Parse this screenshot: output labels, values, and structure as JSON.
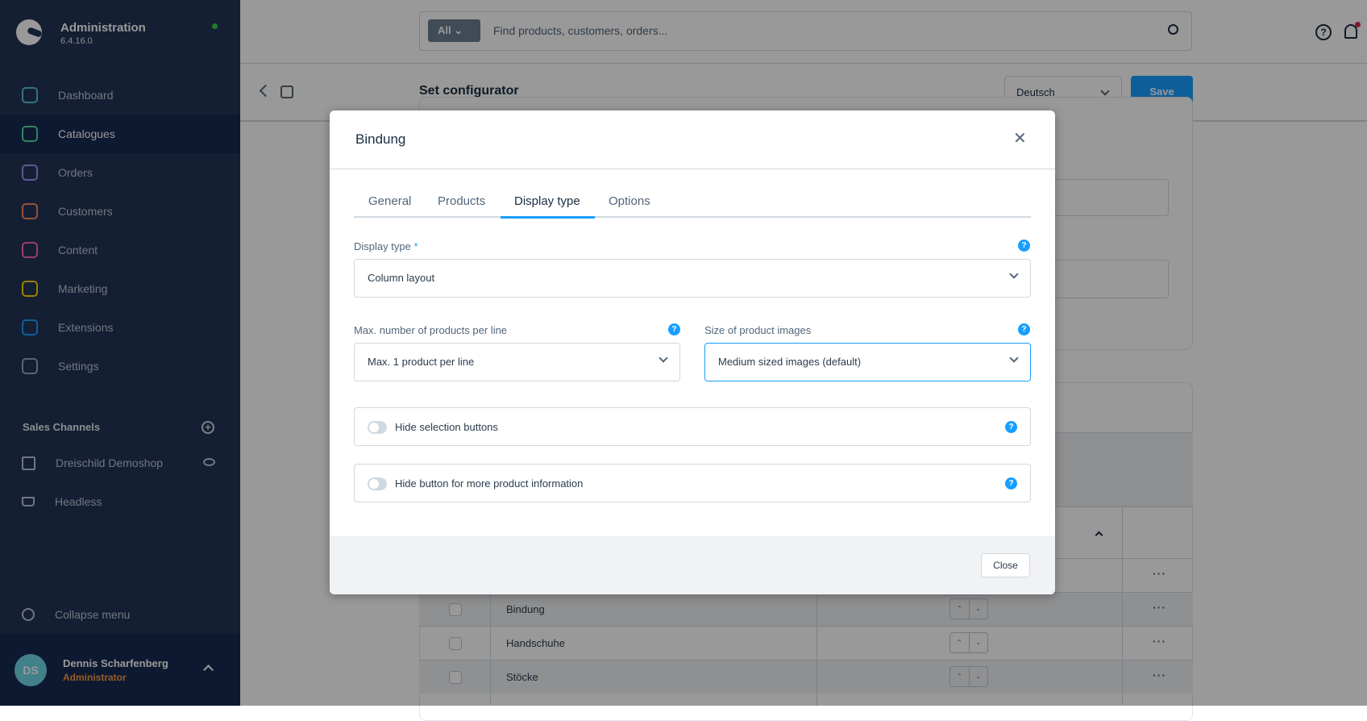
{
  "sidebar": {
    "title": "Administration",
    "version": "6.4.16.0",
    "items": [
      {
        "label": "Dashboard",
        "icon": "dashboard-icon",
        "color": "#56bfdc"
      },
      {
        "label": "Catalogues",
        "icon": "catalogues-icon",
        "color": "#57d9a3"
      },
      {
        "label": "Orders",
        "icon": "orders-icon",
        "color": "#a092f0"
      },
      {
        "label": "Customers",
        "icon": "customers-icon",
        "color": "#f88962"
      },
      {
        "label": "Content",
        "icon": "content-icon",
        "color": "#ff68b4"
      },
      {
        "label": "Marketing",
        "icon": "marketing-icon",
        "color": "#ffd700"
      },
      {
        "label": "Extensions",
        "icon": "extensions-icon",
        "color": "#189eff"
      },
      {
        "label": "Settings",
        "icon": "settings-icon",
        "color": "#9aa8b5"
      }
    ],
    "active": "Catalogues",
    "sales_channels_title": "Sales Channels",
    "sales_channels": [
      {
        "label": "Dreischild Demoshop"
      },
      {
        "label": "Headless"
      }
    ],
    "collapse": "Collapse menu",
    "user": {
      "initials": "DS",
      "name": "Dennis Scharfenberg",
      "role": "Administrator"
    }
  },
  "topbar": {
    "search_filter": "All",
    "search_placeholder": "Find products, customers, orders..."
  },
  "toolbar": {
    "title": "Set configurator",
    "language": "Deutsch",
    "save": "Save"
  },
  "table": {
    "rows": [
      "Bindung",
      "Handschuhe",
      "Stöcke"
    ]
  },
  "modal": {
    "title": "Bindung",
    "tabs": [
      "General",
      "Products",
      "Display type",
      "Options"
    ],
    "active_tab": "Display type",
    "display_type_label": "Display type",
    "required_mark": "*",
    "display_type_value": "Column layout",
    "max_products_label": "Max. number of products per line",
    "max_products_value": "Max. 1 product per line",
    "image_size_label": "Size of product images",
    "image_size_value": "Medium sized images (default)",
    "toggles": [
      {
        "label": "Hide selection buttons",
        "on": false
      },
      {
        "label": "Hide button for more product information",
        "on": false
      }
    ],
    "close": "Close"
  },
  "colors": {
    "accent": "#189eff",
    "sidebar": "#233455"
  }
}
